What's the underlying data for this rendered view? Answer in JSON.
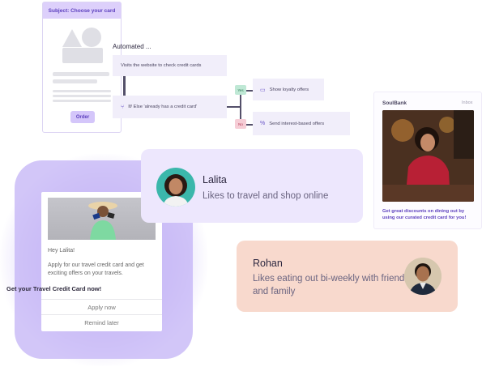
{
  "email_template": {
    "subject": "Subject: Choose your card",
    "order_button": "Order"
  },
  "workflow": {
    "title": "Automated ...",
    "step_visit": "Visits the website to check credit cards",
    "step_ifelse": "If/ Else 'already has a credit card'",
    "badge_yes": "Yes",
    "badge_no": "No",
    "branch_yes": "Show loyalty offers",
    "branch_no": "Send interest-based offers"
  },
  "social_card": {
    "greeting": "Hey Lalita!",
    "body": "Apply for our travel credit card and get exciting offers on your travels.",
    "cta": "Get your Travel Credit Card now!",
    "apply_button": "Apply now",
    "remind_button": "Remind later"
  },
  "lalita": {
    "name": "Lalita",
    "description": "Likes to travel and shop online"
  },
  "bank_email": {
    "brand": "SoulBank",
    "folder": "Inbox",
    "message": "Get great discounts on dining out by using our curated credit card for you!"
  },
  "rohan": {
    "name": "Rohan",
    "description": "Likes eating out bi-weekly with friends and family"
  },
  "colors": {
    "accent_purple": "#5c3fbe",
    "lalita_bg": "#ede7fd",
    "rohan_bg": "#f8d9cd",
    "yes_badge": "#bfe8d5",
    "no_badge": "#f6cdd6"
  }
}
